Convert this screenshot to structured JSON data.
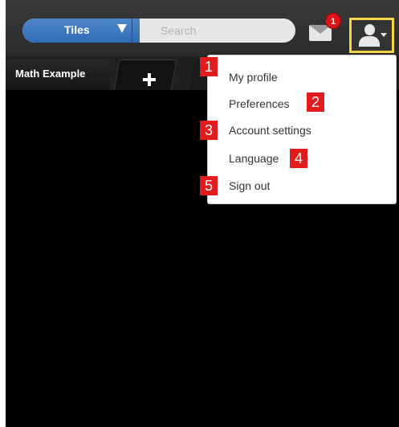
{
  "header": {
    "tiles_label": "Tiles",
    "search_placeholder": "Search",
    "mail_badge": "1"
  },
  "tabs": {
    "active_label": "Math Example"
  },
  "user_menu": {
    "items": [
      {
        "label": "My profile",
        "marker": "1"
      },
      {
        "label": "Preferences",
        "marker": "2"
      },
      {
        "label": "Account settings",
        "marker": "3"
      },
      {
        "label": "Language",
        "marker": "4"
      },
      {
        "label": "Sign out",
        "marker": "5"
      }
    ]
  },
  "colors": {
    "accent_blue": "#2f6bb5",
    "badge_red": "#d9141a",
    "marker_red": "#e21c1c",
    "highlight_yellow": "#f3d54a"
  },
  "icons": {
    "menu_toggle": "user-icon",
    "mail": "envelope-icon",
    "add_tab": "plus-icon",
    "dropdown": "caret-down-icon"
  }
}
